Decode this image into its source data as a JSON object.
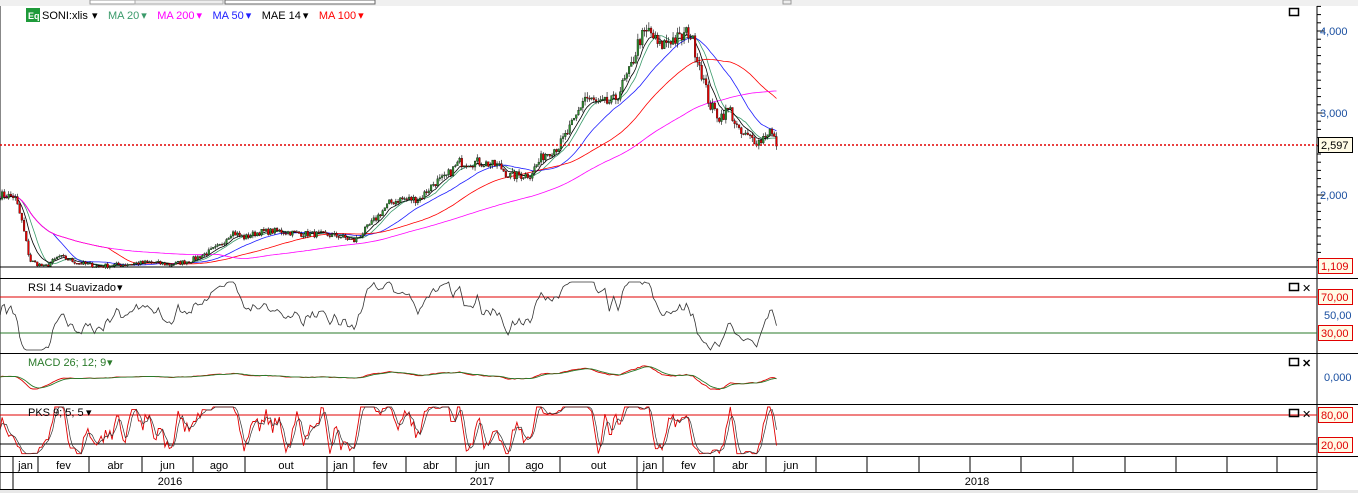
{
  "header": {
    "symbol_badge": "Eq",
    "symbol": "SONI:xlis",
    "studies": [
      {
        "label": "MA 20",
        "color": "#3a9a6a"
      },
      {
        "label": "MA 200",
        "color": "#ff00ff"
      },
      {
        "label": "MA 50",
        "color": "#2020ff"
      },
      {
        "label": "MAE 14",
        "color": "#000000"
      },
      {
        "label": "MA 100",
        "color": "#ff0000"
      }
    ]
  },
  "panels": {
    "price": {
      "last_price": "2,597",
      "low_marker": "1,109",
      "ticks": [
        "4,000",
        "3,000",
        "2,000"
      ]
    },
    "rsi": {
      "title": "RSI 14 Suavizado",
      "upper": "70,00",
      "mid": "50,00",
      "lower": "30,00"
    },
    "macd": {
      "title": "MACD 26; 12; 9",
      "zero": "0,000"
    },
    "pks": {
      "title": "PKS 9; 5; 5",
      "upper": "80,00",
      "lower": "20,00"
    }
  },
  "time_axis": {
    "months": [
      "jan",
      "fev",
      "abr",
      "jun",
      "ago",
      "out",
      "jan",
      "fev",
      "abr",
      "jun",
      "ago",
      "out",
      "jan",
      "fev",
      "abr",
      "jun"
    ],
    "years": [
      "2016",
      "2017",
      "2018"
    ]
  },
  "colors": {
    "up": "#2e8b2e",
    "down": "#e00000",
    "ma20": "#3a9a6a",
    "ma50": "#2020ff",
    "ma100": "#ff0000",
    "ma200": "#ff00ff",
    "ema14": "#000000",
    "last_line": "#e00000"
  },
  "chart_data": {
    "type": "line",
    "title": "SONI:xlis",
    "scale": "linear",
    "ylim": [
      1109,
      4300
    ],
    "x": [
      "2015-12-16",
      "2016-01-03",
      "2016-01-11",
      "2016-01-21",
      "2016-02-08",
      "2016-02-25",
      "2016-03-18",
      "2016-04-11",
      "2016-05-05",
      "2016-06-10",
      "2016-07-03",
      "2016-07-27",
      "2016-08-14",
      "2016-09-01",
      "2016-09-15",
      "2016-09-30",
      "2016-10-17",
      "2016-11-10",
      "2016-12-04",
      "2016-12-27",
      "2017-01-20",
      "2017-02-07",
      "2017-02-18",
      "2017-03-01",
      "2017-03-18",
      "2017-03-31",
      "2017-04-23",
      "2017-05-10",
      "2017-05-22",
      "2017-06-09",
      "2017-07-03",
      "2017-07-26",
      "2017-08-07",
      "2017-09-01",
      "2017-09-18",
      "2017-10-05",
      "2017-10-23",
      "2017-11-04",
      "2017-11-22",
      "2017-12-09",
      "2017-12-27",
      "2018-01-08",
      "2018-01-20",
      "2018-02-01",
      "2018-02-13",
      "2018-02-25",
      "2018-03-06",
      "2018-03-18",
      "2018-03-30",
      "2018-04-11",
      "2018-04-23",
      "2018-05-04",
      "2018-05-16",
      "2018-05-28",
      "2018-06-09",
      "2018-06-18"
    ],
    "series": [
      {
        "values": [
          2000,
          1980,
          1700,
          1200,
          1120,
          1250,
          1170,
          1130,
          1150,
          1180,
          1150,
          1200,
          1280,
          1380,
          1550,
          1480,
          1550,
          1560,
          1530,
          1520,
          1500,
          1440,
          1550,
          1700,
          1900,
          1950,
          1950,
          2150,
          2200,
          2400,
          2400,
          2350,
          2230,
          2250,
          2500,
          2600,
          2900,
          3200,
          3100,
          3150,
          3500,
          3900,
          4000,
          3800,
          3900,
          3900,
          4000,
          3600,
          3100,
          2950,
          3050,
          2750,
          2700,
          2650,
          2800,
          2597
        ]
      }
    ]
  }
}
